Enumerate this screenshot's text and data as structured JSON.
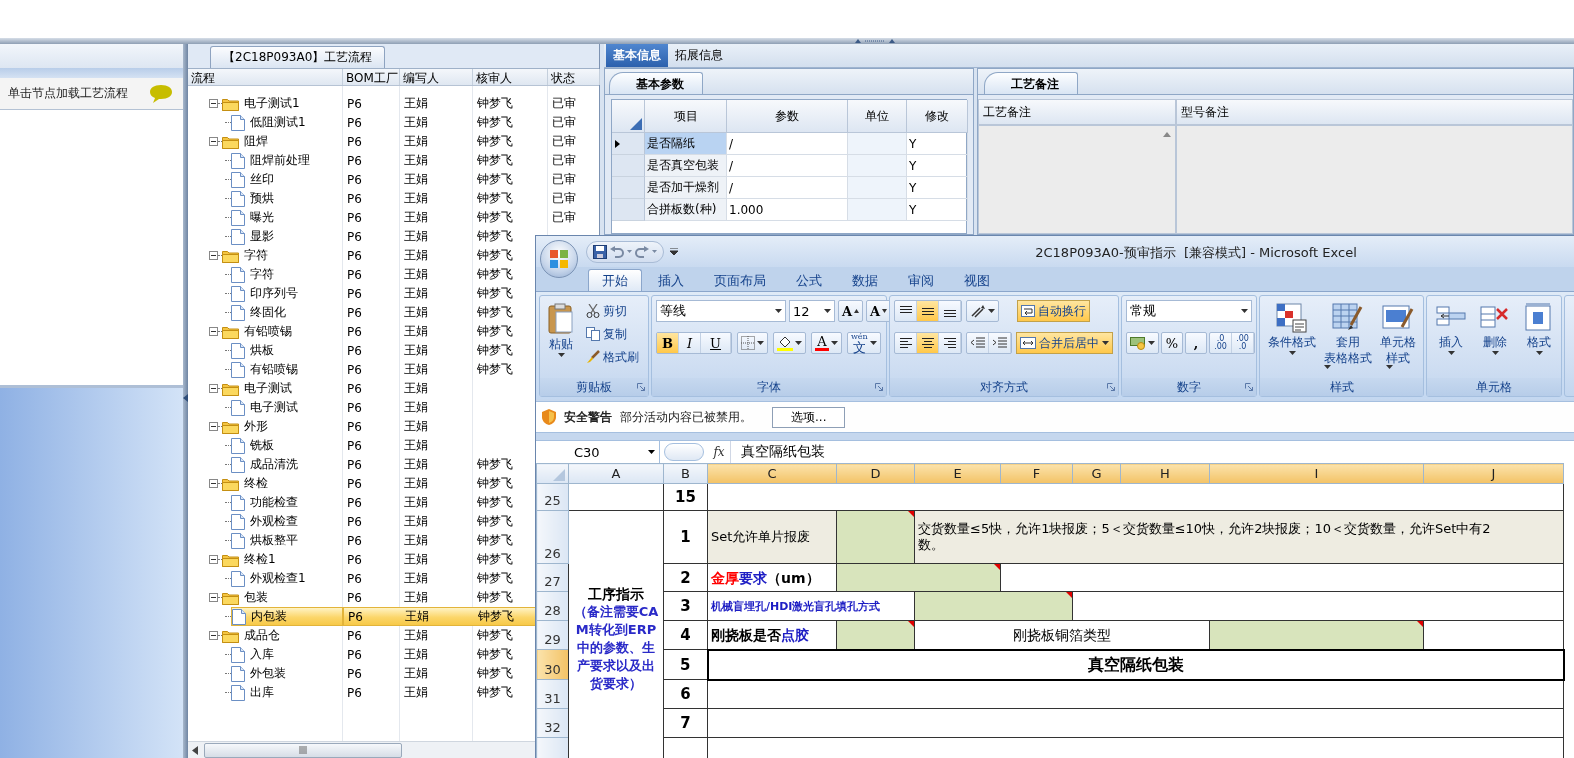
{
  "left_panel": {
    "hint": "单击节点加载工艺流程"
  },
  "process_tree": {
    "title": "【2C18P093A0】工艺流程",
    "columns": [
      "流程",
      "BOM工厂",
      "编写人",
      "核审人",
      "状态"
    ],
    "nodes": [
      {
        "name": "电子测试1",
        "bom": "P6",
        "writer": "王娟",
        "reviewer": "钟梦飞",
        "status": "已审",
        "selected": false,
        "expanded": true,
        "children": [
          {
            "name": "低阻测试1",
            "bom": "P6",
            "writer": "王娟",
            "reviewer": "钟梦飞",
            "status": "已审",
            "selected": false
          }
        ]
      },
      {
        "name": "阻焊",
        "bom": "P6",
        "writer": "王娟",
        "reviewer": "钟梦飞",
        "status": "已审",
        "selected": false,
        "expanded": true,
        "children": [
          {
            "name": "阻焊前处理",
            "bom": "P6",
            "writer": "王娟",
            "reviewer": "钟梦飞",
            "status": "已审",
            "selected": false
          },
          {
            "name": "丝印",
            "bom": "P6",
            "writer": "王娟",
            "reviewer": "钟梦飞",
            "status": "已审",
            "selected": false
          },
          {
            "name": "预烘",
            "bom": "P6",
            "writer": "王娟",
            "reviewer": "钟梦飞",
            "status": "已审",
            "selected": false
          },
          {
            "name": "曝光",
            "bom": "P6",
            "writer": "王娟",
            "reviewer": "钟梦飞",
            "status": "已审",
            "selected": false
          },
          {
            "name": "显影",
            "bom": "P6",
            "writer": "王娟",
            "reviewer": "钟梦飞",
            "selected": false
          }
        ]
      },
      {
        "name": "字符",
        "bom": "P6",
        "writer": "王娟",
        "reviewer": "钟梦飞",
        "selected": false,
        "expanded": true,
        "children": [
          {
            "name": "字符",
            "bom": "P6",
            "writer": "王娟",
            "reviewer": "钟梦飞",
            "selected": false
          },
          {
            "name": "印序列号",
            "bom": "P6",
            "writer": "王娟",
            "reviewer": "钟梦飞",
            "selected": false
          },
          {
            "name": "终固化",
            "bom": "P6",
            "writer": "王娟",
            "reviewer": "钟梦飞",
            "selected": false
          }
        ]
      },
      {
        "name": "有铅喷锡",
        "bom": "P6",
        "writer": "王娟",
        "reviewer": "钟梦飞",
        "selected": false,
        "expanded": true,
        "children": [
          {
            "name": "烘板",
            "bom": "P6",
            "writer": "王娟",
            "reviewer": "钟梦飞",
            "selected": false
          },
          {
            "name": "有铅喷锡",
            "bom": "P6",
            "writer": "王娟",
            "reviewer": "钟梦飞",
            "selected": false
          }
        ]
      },
      {
        "name": "电子测试",
        "bom": "P6",
        "writer": "王娟",
        "selected": false,
        "expanded": true,
        "children": [
          {
            "name": "电子测试",
            "bom": "P6",
            "writer": "王娟",
            "selected": false
          }
        ]
      },
      {
        "name": "外形",
        "bom": "P6",
        "writer": "王娟",
        "selected": false,
        "expanded": true,
        "children": [
          {
            "name": "铣板",
            "bom": "P6",
            "writer": "王娟",
            "selected": false
          },
          {
            "name": "成品清洗",
            "bom": "P6",
            "writer": "王娟",
            "reviewer": "钟梦飞",
            "selected": false
          }
        ]
      },
      {
        "name": "终检",
        "bom": "P6",
        "writer": "王娟",
        "reviewer": "钟梦飞",
        "selected": false,
        "expanded": true,
        "children": [
          {
            "name": "功能检查",
            "bom": "P6",
            "writer": "王娟",
            "reviewer": "钟梦飞",
            "selected": false
          },
          {
            "name": "外观检查",
            "bom": "P6",
            "writer": "王娟",
            "reviewer": "钟梦飞",
            "selected": false
          },
          {
            "name": "烘板整平",
            "bom": "P6",
            "writer": "王娟",
            "reviewer": "钟梦飞",
            "selected": false
          }
        ]
      },
      {
        "name": "终检1",
        "bom": "P6",
        "writer": "王娟",
        "reviewer": "钟梦飞",
        "selected": false,
        "expanded": true,
        "children": [
          {
            "name": "外观检查1",
            "bom": "P6",
            "writer": "王娟",
            "reviewer": "钟梦飞",
            "selected": false
          }
        ]
      },
      {
        "name": "包装",
        "bom": "P6",
        "writer": "王娟",
        "reviewer": "钟梦飞",
        "selected": false,
        "expanded": true,
        "children": [
          {
            "name": "内包装",
            "bom": "P6",
            "writer": "王娟",
            "reviewer": "钟梦飞",
            "selected": true
          }
        ]
      },
      {
        "name": "成品仓",
        "bom": "P6",
        "writer": "王娟",
        "reviewer": "钟梦飞",
        "selected": false,
        "expanded": true,
        "children": [
          {
            "name": "入库",
            "bom": "P6",
            "writer": "王娟",
            "reviewer": "钟梦飞",
            "selected": false
          },
          {
            "name": "外包装",
            "bom": "P6",
            "writer": "王娟",
            "reviewer": "钟梦飞",
            "selected": false
          },
          {
            "name": "出库",
            "bom": "P6",
            "writer": "王娟",
            "reviewer": "钟梦飞",
            "selected": false
          }
        ]
      }
    ]
  },
  "info_tabs": [
    {
      "label": "基本信息",
      "selected": true
    },
    {
      "label": "拓展信息",
      "selected": false
    }
  ],
  "basic_params": {
    "tab": "基本参数",
    "columns": [
      "项目",
      "参数",
      "单位",
      "修改"
    ],
    "rows": [
      {
        "item": "是否隔纸",
        "value": "/",
        "modified": "Y",
        "selected": true
      },
      {
        "item": "是否真空包装",
        "value": "/",
        "modified": "Y",
        "selected": false
      },
      {
        "item": "是否加干燥剂",
        "value": "/",
        "modified": "Y",
        "selected": false
      },
      {
        "item": "合拼板数(种)",
        "value": "1.000",
        "modified": "Y",
        "selected": false
      }
    ]
  },
  "process_notes": {
    "tab": "工艺备注",
    "columns": [
      "工艺备注",
      "型号备注"
    ]
  },
  "excel": {
    "title": "2C18P093A0-预审指示  [兼容模式] - Microsoft Excel",
    "tabs": [
      {
        "label": "开始",
        "selected": true
      },
      {
        "label": "插入",
        "selected": false
      },
      {
        "label": "页面布局",
        "selected": false
      },
      {
        "label": "公式",
        "selected": false
      },
      {
        "label": "数据",
        "selected": false
      },
      {
        "label": "审阅",
        "selected": false
      },
      {
        "label": "视图",
        "selected": false
      }
    ],
    "ribbon": {
      "clipboard": {
        "label": "剪贴板",
        "paste": "粘贴",
        "cut": "剪切",
        "copy": "复制",
        "format_painter": "格式刷"
      },
      "font": {
        "label": "字体",
        "name": "等线",
        "size": "12",
        "grow": "A",
        "shrink": "A",
        "bold": {
          "text": "B",
          "on": true
        },
        "italic": {
          "text": "I",
          "on": false
        },
        "underline": {
          "text": "U",
          "on": false
        },
        "font_color_letter": "A",
        "phonetic_top": "wén",
        "phonetic": "文"
      },
      "alignment": {
        "label": "对齐方式",
        "vertical": [
          {
            "selected": false
          },
          {
            "selected": true
          },
          {
            "selected": false
          }
        ],
        "horizontal": [
          {
            "selected": false
          },
          {
            "selected": true
          },
          {
            "selected": false
          }
        ],
        "wrap": {
          "text": "自动换行",
          "on": true
        },
        "merge": {
          "text": "合并后居中",
          "on": true
        }
      },
      "number": {
        "label": "数字",
        "format": "常规",
        "percent": "%",
        "comma": ",",
        "decimals": [
          {
            "top": ".0",
            "bottom": ".00"
          },
          {
            "top": ".00",
            "bottom": ".0"
          }
        ]
      },
      "styles": {
        "label": "样式",
        "buttons": [
          {
            "lines": [
              "条件格式"
            ],
            "kind": "conditional"
          },
          {
            "lines": [
              "套用",
              "表格格式"
            ],
            "kind": "table"
          },
          {
            "lines": [
              "单元格",
              "样式"
            ],
            "kind": "cell"
          }
        ]
      },
      "cells": {
        "label": "单元格",
        "buttons": [
          {
            "text": "插入",
            "kind": "insert"
          },
          {
            "text": "删除",
            "kind": "delete"
          },
          {
            "text": "格式",
            "kind": "format"
          }
        ]
      }
    },
    "security": {
      "title": "安全警告",
      "message": "部分活动内容已被禁用。",
      "button": "选项..."
    },
    "formula_bar": {
      "cell": "C30",
      "fx": "fx",
      "value": "真空隔纸包装"
    },
    "sheet": {
      "columns": [
        {
          "label": "A",
          "selected": false
        },
        {
          "label": "B",
          "selected": false
        },
        {
          "label": "C",
          "selected": true
        },
        {
          "label": "D",
          "selected": true
        },
        {
          "label": "E",
          "selected": true
        },
        {
          "label": "F",
          "selected": true
        },
        {
          "label": "G",
          "selected": true
        },
        {
          "label": "H",
          "selected": true
        },
        {
          "label": "I",
          "selected": true
        },
        {
          "label": "J",
          "selected": true
        }
      ],
      "rows": [
        {
          "header": "25",
          "selected": false,
          "cells": [
            {
              "kind": "blank"
            },
            {
              "kind": "index",
              "text": "15"
            },
            {
              "kind": "blank",
              "colspan": 8
            }
          ]
        },
        {
          "header": "26",
          "selected": false,
          "cells": [
            {
              "kind": "section",
              "title": "工序指示",
              "note": "（备注需要CAM转化到ERP中的参数、生产要求以及出货要求）",
              "rowspan": 8
            },
            {
              "kind": "index",
              "text": "1"
            },
            {
              "kind": "label",
              "text": "Set允许单片报废"
            },
            {
              "kind": "input",
              "comment": true
            },
            {
              "kind": "note",
              "text": "交货数量≤5快，允许1块报废；5＜交货数量≤10快，允许2块报废；10＜交货数量，允许Set中有2\n数。",
              "colspan": 6
            }
          ]
        },
        {
          "header": "27",
          "selected": false,
          "cells": [
            {
              "kind": "index",
              "text": "2"
            },
            {
              "kind": "rich",
              "parts": [
                {
                  "text": "金厚",
                  "color": "#ff0000"
                },
                {
                  "text": "要求",
                  "color": "#1d1dc4"
                },
                {
                  "text": "（um）",
                  "color": "#000000"
                }
              ]
            },
            {
              "kind": "input",
              "comment": true,
              "colspan": 2
            },
            {
              "kind": "blank",
              "colspan": 5
            }
          ]
        },
        {
          "header": "28",
          "selected": false,
          "cells": [
            {
              "kind": "index",
              "text": "3"
            },
            {
              "kind": "heading",
              "text": "机械盲埋孔/HDI激光盲孔填孔方式",
              "colspan": 2
            },
            {
              "kind": "input",
              "comment": true,
              "colspan": 2
            },
            {
              "kind": "blank",
              "colspan": 4
            }
          ]
        },
        {
          "header": "29",
          "selected": false,
          "cells": [
            {
              "kind": "index",
              "text": "4"
            },
            {
              "kind": "rich",
              "parts": [
                {
                  "text": "刚挠板是否",
                  "color": "#000000"
                },
                {
                  "text": "点胶",
                  "color": "#1d1dc4"
                }
              ]
            },
            {
              "kind": "input",
              "comment": true
            },
            {
              "kind": "plain",
              "text": "刚挠板铜箔类型",
              "colspan": 4
            },
            {
              "kind": "input",
              "comment": true
            },
            {
              "kind": "blank"
            }
          ]
        },
        {
          "header": "30",
          "selected": true,
          "cells": [
            {
              "kind": "index",
              "text": "5"
            },
            {
              "kind": "title",
              "text": "真空隔纸包装",
              "active": true,
              "colspan": 8
            }
          ]
        },
        {
          "header": "31",
          "selected": false,
          "cells": [
            {
              "kind": "index",
              "text": "6"
            },
            {
              "kind": "blank",
              "colspan": 8
            }
          ]
        },
        {
          "header": "32",
          "selected": false,
          "cells": [
            {
              "kind": "index",
              "text": "7"
            },
            {
              "kind": "blank",
              "colspan": 8
            }
          ]
        }
      ]
    }
  }
}
